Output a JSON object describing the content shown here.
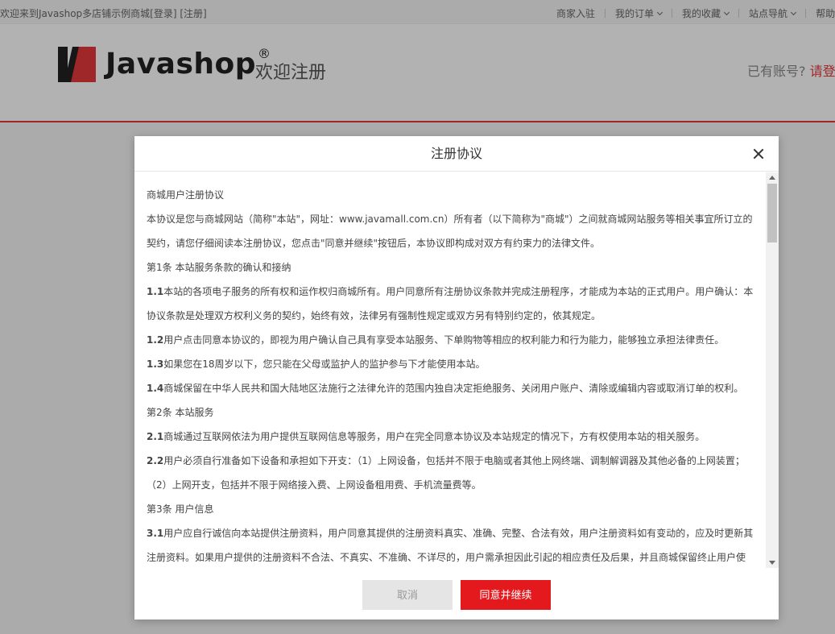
{
  "topbar": {
    "welcome": "欢迎来到Javashop多店铺示例商城",
    "login_link": "[登录]",
    "register_link": "[注册]",
    "links": [
      {
        "label": "商家入驻",
        "dropdown": false
      },
      {
        "label": "我的订单",
        "dropdown": true
      },
      {
        "label": "我的收藏",
        "dropdown": true
      },
      {
        "label": "站点导航",
        "dropdown": true
      },
      {
        "label": "帮助",
        "dropdown": false
      }
    ]
  },
  "header": {
    "logo_text": "Javashop",
    "logo_reg": "®",
    "subtitle": "欢迎注册",
    "have_account": "已有账号?",
    "login_prompt": "请登录"
  },
  "dialog": {
    "title": "注册协议",
    "paragraphs": [
      {
        "num": "",
        "text": "商城用户注册协议"
      },
      {
        "num": "",
        "text": "本协议是您与商城网站（简称\"本站\"，网址：www.javamall.com.cn）所有者（以下简称为\"商城\"）之间就商城网站服务等相关事宜所订立的契约，请您仔细阅读本注册协议，您点击\"同意并继续\"按钮后，本协议即构成对双方有约束力的法律文件。"
      },
      {
        "num": "",
        "text": "第1条 本站服务条款的确认和接纳"
      },
      {
        "num": "1.1",
        "text": "本站的各项电子服务的所有权和运作权归商城所有。用户同意所有注册协议条款并完成注册程序，才能成为本站的正式用户。用户确认：本协议条款是处理双方权利义务的契约，始终有效，法律另有强制性规定或双方另有特别约定的，依其规定。"
      },
      {
        "num": "1.2",
        "text": "用户点击同意本协议的，即视为用户确认自己具有享受本站服务、下单购物等相应的权利能力和行为能力，能够独立承担法律责任。"
      },
      {
        "num": "1.3",
        "text": "如果您在18周岁以下，您只能在父母或监护人的监护参与下才能使用本站。"
      },
      {
        "num": "1.4",
        "text": "商城保留在中华人民共和国大陆地区法施行之法律允许的范围内独自决定拒绝服务、关闭用户账户、清除或编辑内容或取消订单的权利。"
      },
      {
        "num": "",
        "text": "第2条 本站服务"
      },
      {
        "num": "2.1",
        "text": "商城通过互联网依法为用户提供互联网信息等服务，用户在完全同意本协议及本站规定的情况下，方有权使用本站的相关服务。"
      },
      {
        "num": "2.2",
        "text": "用户必须自行准备如下设备和承担如下开支：（1）上网设备，包括并不限于电脑或者其他上网终端、调制解调器及其他必备的上网装置；（2）上网开支，包括并不限于网络接入费、上网设备租用费、手机流量费等。"
      },
      {
        "num": "",
        "text": "第3条 用户信息"
      },
      {
        "num": "3.1",
        "text": "用户应自行诚信向本站提供注册资料，用户同意其提供的注册资料真实、准确、完整、合法有效，用户注册资料如有变动的，应及时更新其注册资料。如果用户提供的注册资料不合法、不真实、不准确、不详尽的，用户需承担因此引起的相应责任及后果，并且商城保留终止用户使"
      }
    ],
    "cancel_label": "取消",
    "agree_label": "同意并继续"
  },
  "colors": {
    "accent": "#e4393c",
    "agree_button": "#e4191e",
    "cancel_button": "#e5e5e5"
  }
}
